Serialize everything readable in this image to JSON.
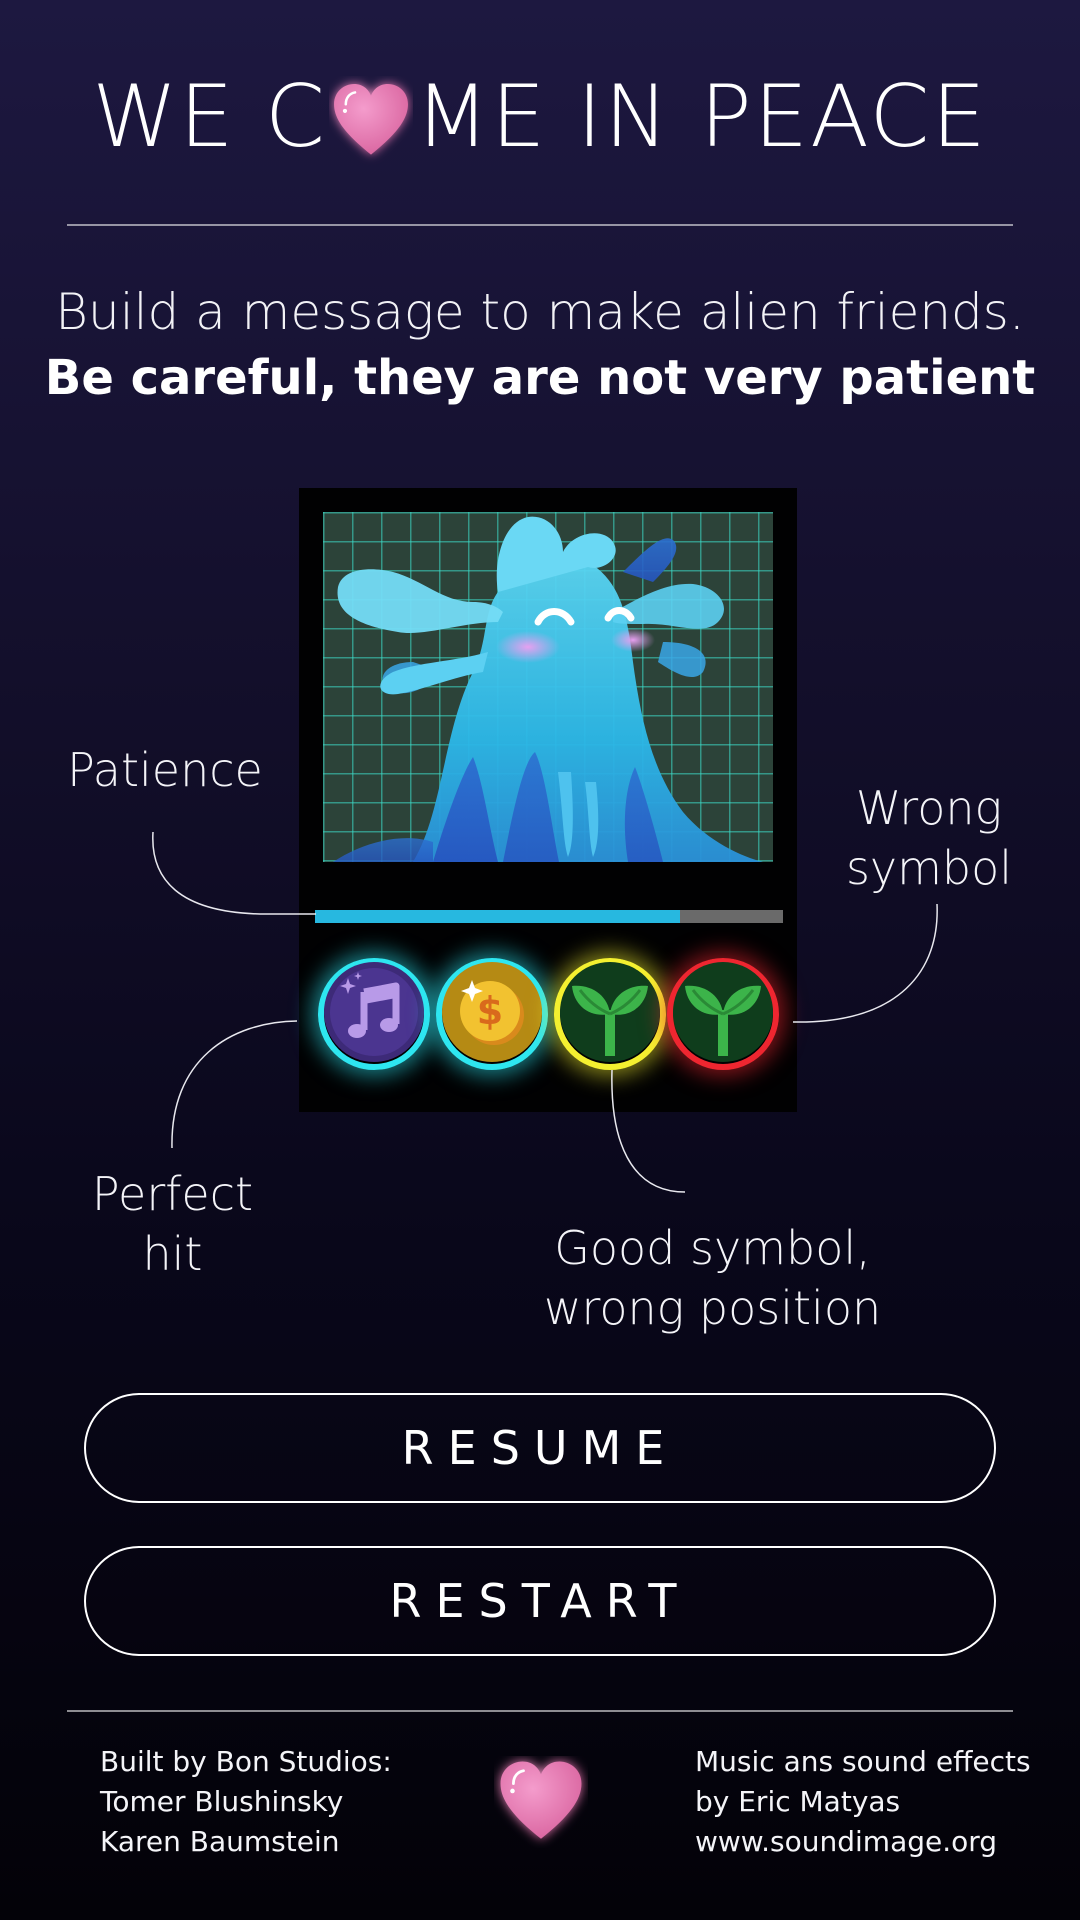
{
  "header": {
    "title_before": "WE C",
    "title_after": "ME IN PEACE"
  },
  "intro": {
    "line1": "Build a message to make alien friends.",
    "line2": "Be careful, they are not very patient"
  },
  "game": {
    "patience": 0.78,
    "symbols": [
      {
        "icon": "music-note-icon",
        "status": "perfect"
      },
      {
        "icon": "coin-icon",
        "status": "perfect"
      },
      {
        "icon": "sprout-icon",
        "status": "good-symbol-wrong-position"
      },
      {
        "icon": "sprout-icon",
        "status": "wrong"
      }
    ]
  },
  "labels": {
    "patience": "Patience",
    "wrong_line1": "Wrong",
    "wrong_line2": "symbol",
    "perfect_line1": "Perfect",
    "perfect_line2": "hit",
    "good_line1": "Good symbol,",
    "good_line2": "wrong position"
  },
  "buttons": {
    "resume": "RESUME",
    "restart": "RESTART"
  },
  "footer": {
    "left": [
      "Built by Bon Studios:",
      "Tomer Blushinsky",
      "Karen Baumstein"
    ],
    "right": [
      "Music ans sound effects",
      "by Eric Matyas",
      "www.soundimage.org"
    ]
  },
  "colors": {
    "perfect": "#2ee6f0",
    "good": "#f4f030",
    "wrong": "#ee2630",
    "heart": "#e07ab4",
    "patience_bar": "#27b8e0"
  }
}
